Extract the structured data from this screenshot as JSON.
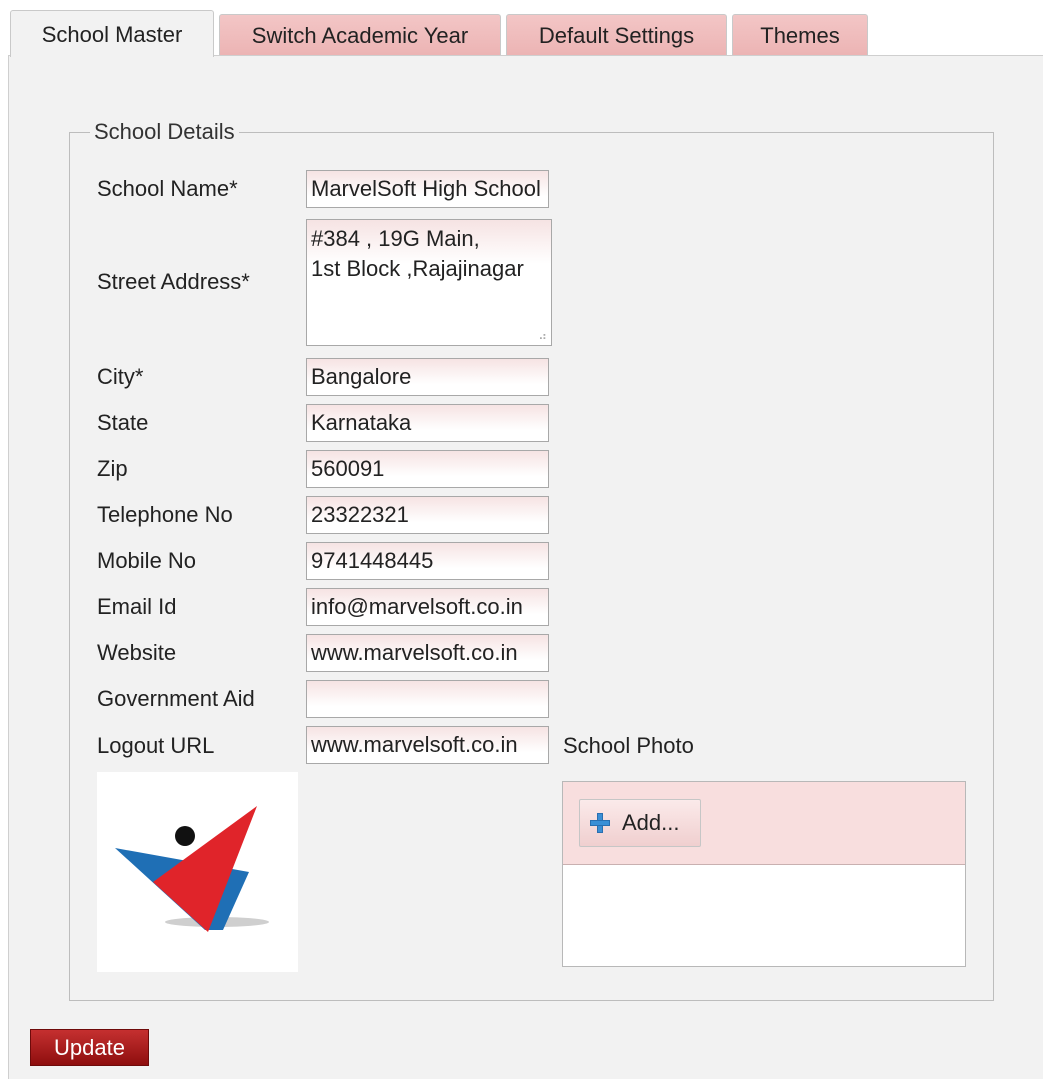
{
  "tabs": [
    {
      "label": "School Master",
      "active": true
    },
    {
      "label": "Switch Academic Year"
    },
    {
      "label": "Default Settings"
    },
    {
      "label": "Themes"
    }
  ],
  "section_title": "School Details",
  "fields": {
    "school_name": {
      "label": "School Name*",
      "value": "MarvelSoft High School"
    },
    "street_address": {
      "label": "Street Address*",
      "line1": "#384 , 19G Main,",
      "line2": "1st Block ,Rajajinagar"
    },
    "city": {
      "label": "City*",
      "value": "Bangalore"
    },
    "state": {
      "label": "State",
      "value": "Karnataka"
    },
    "zip": {
      "label": "Zip",
      "value": "560091"
    },
    "telephone": {
      "label": "Telephone No",
      "value": "23322321"
    },
    "mobile": {
      "label": "Mobile No",
      "value": "9741448445"
    },
    "email": {
      "label": "Email Id",
      "value": "info@marvelsoft.co.in"
    },
    "website": {
      "label": "Website",
      "value": "www.marvelsoft.co.in"
    },
    "government_aid": {
      "label": "Government Aid",
      "value": ""
    },
    "logout_url": {
      "label": "Logout URL",
      "value": "www.marvelsoft.co.in"
    }
  },
  "photo": {
    "label": "School Photo",
    "add_label": "Add..."
  },
  "update_label": "Update",
  "colors": {
    "accent": "#a11414",
    "tab_bg": "#f0bcbc",
    "panel_bg": "#f2f2f2",
    "logo_red": "#e0242a",
    "logo_blue": "#1f6fb5"
  }
}
